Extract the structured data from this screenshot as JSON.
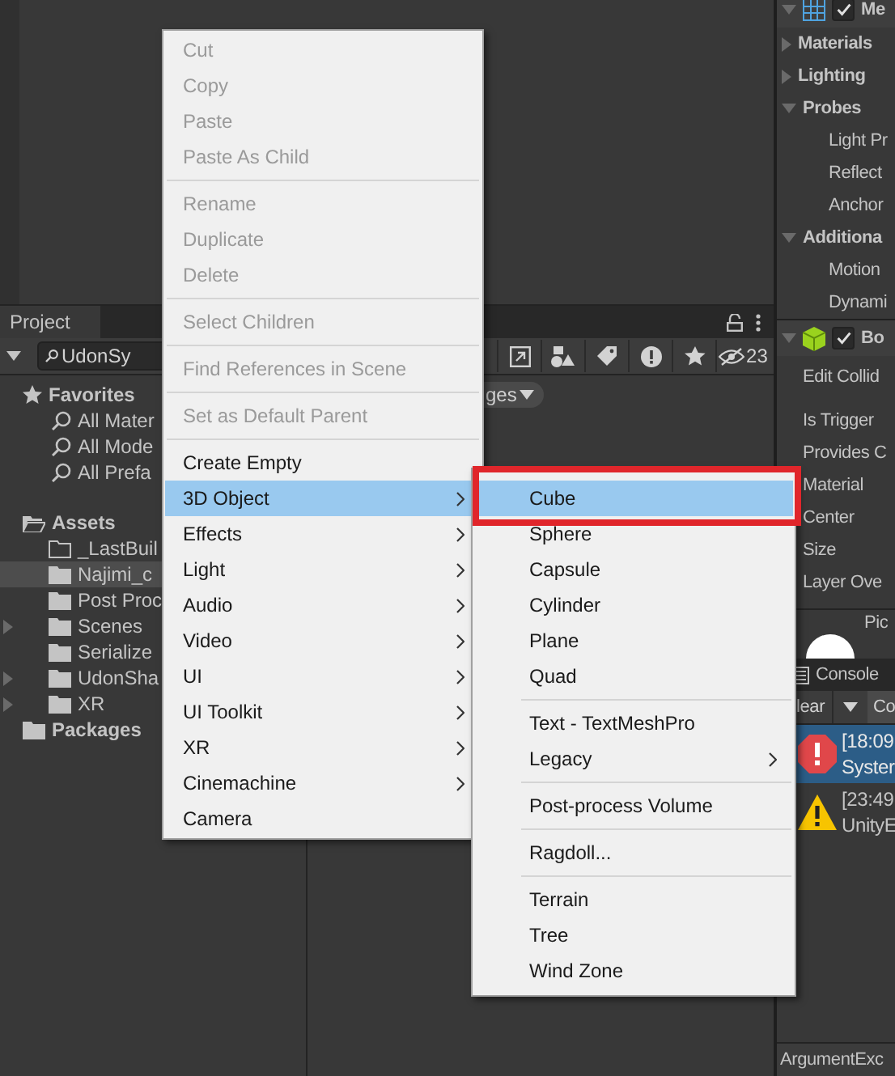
{
  "project_panel": {
    "tab": "Project",
    "search": {
      "value": "UdonSy"
    },
    "hidden_count": "23",
    "breadcrumb": "ges",
    "tree": [
      {
        "label": "Favorites",
        "kind": "favorites",
        "expandable": false,
        "selected": false,
        "children": [
          {
            "label": "All Mater",
            "kind": "search",
            "expandable": false,
            "selected": false
          },
          {
            "label": "All Mode",
            "kind": "search",
            "expandable": false,
            "selected": false
          },
          {
            "label": "All Prefa",
            "kind": "search",
            "expandable": false,
            "selected": false
          }
        ]
      },
      {
        "label": "Assets",
        "kind": "root",
        "expandable": false,
        "selected": false,
        "children": [
          {
            "label": "_LastBuil",
            "kind": "empty-folder",
            "expandable": false,
            "selected": false
          },
          {
            "label": "Najimi_c",
            "kind": "folder",
            "expandable": false,
            "selected": true
          },
          {
            "label": "Post Proc",
            "kind": "folder",
            "expandable": false,
            "selected": false
          },
          {
            "label": "Scenes",
            "kind": "folder",
            "expandable": true,
            "selected": false
          },
          {
            "label": "Serialize",
            "kind": "folder",
            "expandable": false,
            "selected": false
          },
          {
            "label": "UdonSha",
            "kind": "folder",
            "expandable": true,
            "selected": false
          },
          {
            "label": "XR",
            "kind": "folder",
            "expandable": true,
            "selected": false
          }
        ]
      },
      {
        "label": "Packages",
        "kind": "root",
        "expandable": false,
        "selected": false
      }
    ]
  },
  "inspector": {
    "rows": [
      {
        "kind": "component",
        "label": "Me",
        "enabled": true
      },
      {
        "kind": "foldout",
        "label": "Materials",
        "expanded": false
      },
      {
        "kind": "foldout",
        "label": "Lighting",
        "expanded": false
      },
      {
        "kind": "foldout",
        "label": "Probes",
        "expanded": true
      },
      {
        "kind": "sub",
        "label": "Light Pr"
      },
      {
        "kind": "sub",
        "label": "Reflect"
      },
      {
        "kind": "sub",
        "label": "Anchor"
      },
      {
        "kind": "foldout",
        "label": "Additiona",
        "expanded": true
      },
      {
        "kind": "sub",
        "label": "Motion"
      },
      {
        "kind": "sub",
        "label": "Dynami"
      },
      {
        "kind": "component",
        "label": "Bo",
        "enabled": true
      },
      {
        "kind": "button",
        "label": "Edit Collid"
      },
      {
        "kind": "field",
        "label": "Is Trigger"
      },
      {
        "kind": "field",
        "label": "Provides C"
      },
      {
        "kind": "field",
        "label": "Material"
      },
      {
        "kind": "field",
        "label": "Center"
      },
      {
        "kind": "field",
        "label": "Size"
      },
      {
        "kind": "foldout-field",
        "label": "Layer Ove"
      }
    ],
    "preview": "Pic"
  },
  "console": {
    "tab": "Console",
    "clear_button": "lear",
    "collapse_button": "Co",
    "entries": [
      {
        "kind": "error",
        "time": "[18:09",
        "message": "Syster",
        "selected": true
      },
      {
        "kind": "warning",
        "time": "[23:49",
        "message": "UnityE",
        "selected": false
      }
    ]
  },
  "status_bar": "ArgumentExc",
  "context_menu": {
    "items": [
      {
        "kind": "item",
        "label": "Cut",
        "disabled": true,
        "has_submenu": false,
        "selected": false
      },
      {
        "kind": "item",
        "label": "Copy",
        "disabled": true,
        "has_submenu": false,
        "selected": false
      },
      {
        "kind": "item",
        "label": "Paste",
        "disabled": true,
        "has_submenu": false,
        "selected": false
      },
      {
        "kind": "item",
        "label": "Paste As Child",
        "disabled": true,
        "has_submenu": false,
        "selected": false
      },
      {
        "kind": "separator"
      },
      {
        "kind": "item",
        "label": "Rename",
        "disabled": true,
        "has_submenu": false,
        "selected": false
      },
      {
        "kind": "item",
        "label": "Duplicate",
        "disabled": true,
        "has_submenu": false,
        "selected": false
      },
      {
        "kind": "item",
        "label": "Delete",
        "disabled": true,
        "has_submenu": false,
        "selected": false
      },
      {
        "kind": "separator"
      },
      {
        "kind": "item",
        "label": "Select Children",
        "disabled": true,
        "has_submenu": false,
        "selected": false
      },
      {
        "kind": "separator"
      },
      {
        "kind": "item",
        "label": "Find References in Scene",
        "disabled": true,
        "has_submenu": false,
        "selected": false
      },
      {
        "kind": "separator"
      },
      {
        "kind": "item",
        "label": "Set as Default Parent",
        "disabled": true,
        "has_submenu": false,
        "selected": false
      },
      {
        "kind": "separator"
      },
      {
        "kind": "item",
        "label": "Create Empty",
        "disabled": false,
        "has_submenu": false,
        "selected": false
      },
      {
        "kind": "item",
        "label": "3D Object",
        "disabled": false,
        "has_submenu": true,
        "selected": true
      },
      {
        "kind": "item",
        "label": "Effects",
        "disabled": false,
        "has_submenu": true,
        "selected": false
      },
      {
        "kind": "item",
        "label": "Light",
        "disabled": false,
        "has_submenu": true,
        "selected": false
      },
      {
        "kind": "item",
        "label": "Audio",
        "disabled": false,
        "has_submenu": true,
        "selected": false
      },
      {
        "kind": "item",
        "label": "Video",
        "disabled": false,
        "has_submenu": true,
        "selected": false
      },
      {
        "kind": "item",
        "label": "UI",
        "disabled": false,
        "has_submenu": true,
        "selected": false
      },
      {
        "kind": "item",
        "label": "UI Toolkit",
        "disabled": false,
        "has_submenu": true,
        "selected": false
      },
      {
        "kind": "item",
        "label": "XR",
        "disabled": false,
        "has_submenu": true,
        "selected": false
      },
      {
        "kind": "item",
        "label": "Cinemachine",
        "disabled": false,
        "has_submenu": true,
        "selected": false
      },
      {
        "kind": "item",
        "label": "Camera",
        "disabled": false,
        "has_submenu": false,
        "selected": false
      }
    ]
  },
  "submenu": {
    "items": [
      {
        "kind": "item",
        "label": "Cube",
        "disabled": false,
        "has_submenu": false,
        "selected": true,
        "outlined": true
      },
      {
        "kind": "item",
        "label": "Sphere",
        "disabled": false,
        "has_submenu": false,
        "selected": false,
        "outlined": false
      },
      {
        "kind": "item",
        "label": "Capsule",
        "disabled": false,
        "has_submenu": false,
        "selected": false,
        "outlined": false
      },
      {
        "kind": "item",
        "label": "Cylinder",
        "disabled": false,
        "has_submenu": false,
        "selected": false,
        "outlined": false
      },
      {
        "kind": "item",
        "label": "Plane",
        "disabled": false,
        "has_submenu": false,
        "selected": false,
        "outlined": false
      },
      {
        "kind": "item",
        "label": "Quad",
        "disabled": false,
        "has_submenu": false,
        "selected": false,
        "outlined": false
      },
      {
        "kind": "separator"
      },
      {
        "kind": "item",
        "label": "Text - TextMeshPro",
        "disabled": false,
        "has_submenu": false,
        "selected": false,
        "outlined": false
      },
      {
        "kind": "item",
        "label": "Legacy",
        "disabled": false,
        "has_submenu": true,
        "selected": false,
        "outlined": false
      },
      {
        "kind": "separator"
      },
      {
        "kind": "item",
        "label": "Post-process Volume",
        "disabled": false,
        "has_submenu": false,
        "selected": false,
        "outlined": false
      },
      {
        "kind": "separator"
      },
      {
        "kind": "item",
        "label": "Ragdoll...",
        "disabled": false,
        "has_submenu": false,
        "selected": false,
        "outlined": false
      },
      {
        "kind": "separator"
      },
      {
        "kind": "item",
        "label": "Terrain",
        "disabled": false,
        "has_submenu": false,
        "selected": false,
        "outlined": false
      },
      {
        "kind": "item",
        "label": "Tree",
        "disabled": false,
        "has_submenu": false,
        "selected": false,
        "outlined": false
      },
      {
        "kind": "item",
        "label": "Wind Zone",
        "disabled": false,
        "has_submenu": false,
        "selected": false,
        "outlined": false
      }
    ]
  }
}
